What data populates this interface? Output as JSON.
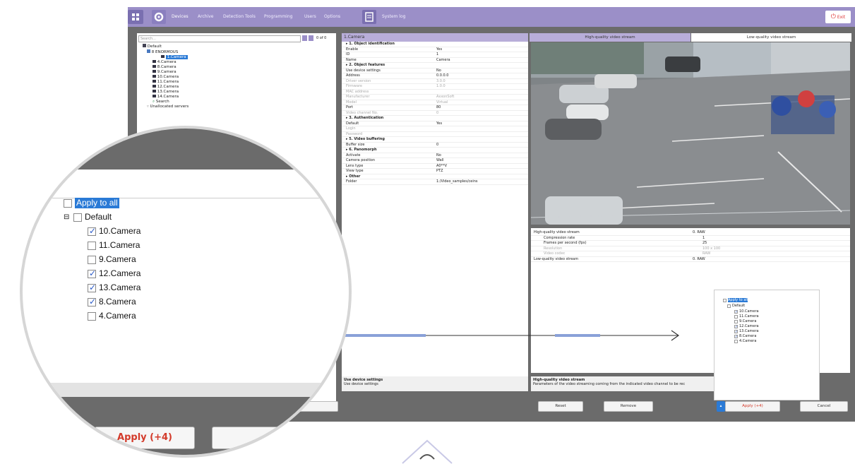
{
  "topbar": {
    "tabs": [
      "Devices",
      "Archive",
      "Detection Tools",
      "Programming",
      "Users",
      "Options"
    ],
    "system_log": "System log",
    "exit": "Exit"
  },
  "left": {
    "search_placeholder": "Search...",
    "search_count": "0 of 0",
    "tree": [
      "Default",
      "8 ENORMOUS",
      "1.Camera",
      "4.Camera",
      "8.Camera",
      "9.Camera",
      "10.Camera",
      "11.Camera",
      "12.Camera",
      "13.Camera",
      "14.Camera",
      "Search",
      "Unallocated servers"
    ]
  },
  "props": {
    "header": "1.Camera",
    "rows": [
      {
        "k": "1. Object identification",
        "v": "",
        "t": "sec"
      },
      {
        "k": "Enable",
        "v": "Yes",
        "t": ""
      },
      {
        "k": "ID",
        "v": "1",
        "t": ""
      },
      {
        "k": "Name",
        "v": "Camera",
        "t": ""
      },
      {
        "k": "2. Object features",
        "v": "",
        "t": "sec"
      },
      {
        "k": "Use device settings",
        "v": "No",
        "t": ""
      },
      {
        "k": "Address",
        "v": "0.0.0.0",
        "t": ""
      },
      {
        "k": "Driver version",
        "v": "3.0.0",
        "t": "dim"
      },
      {
        "k": "Firmware",
        "v": "1.0.0",
        "t": "dim"
      },
      {
        "k": "MAC address",
        "v": "",
        "t": "dim"
      },
      {
        "k": "Manufacturer",
        "v": "AxxonSoft",
        "t": "dim"
      },
      {
        "k": "Model",
        "v": "Virtual",
        "t": "dim"
      },
      {
        "k": "Port",
        "v": "80",
        "t": ""
      },
      {
        "k": "Video channel No.",
        "v": "0",
        "t": "dim"
      },
      {
        "k": "3. Authentication",
        "v": "",
        "t": "sec"
      },
      {
        "k": "Default",
        "v": "Yes",
        "t": ""
      },
      {
        "k": "Login",
        "v": "",
        "t": "dim"
      },
      {
        "k": "Password",
        "v": "",
        "t": "dim"
      },
      {
        "k": "5. Video buffering",
        "v": "",
        "t": "sec"
      },
      {
        "k": "Buffer size",
        "v": "0",
        "t": ""
      },
      {
        "k": "6. Panomorph",
        "v": "",
        "t": "sec"
      },
      {
        "k": "Activate",
        "v": "No",
        "t": ""
      },
      {
        "k": "Camera position",
        "v": "Wall",
        "t": ""
      },
      {
        "k": "Lens type",
        "v": "A0**V",
        "t": ""
      },
      {
        "k": "View type",
        "v": "PTZ",
        "t": ""
      },
      {
        "k": "Other",
        "v": "",
        "t": "sec"
      },
      {
        "k": "Folder",
        "v": "1:/Video_samples/ceins",
        "t": ""
      }
    ],
    "desc_title": "Use device settings",
    "desc_text": "Use device settings"
  },
  "video": {
    "tab_high": "High-quality video stream",
    "tab_low": "Low-quality video stream"
  },
  "streams": {
    "rows": [
      {
        "k": "High-quality video stream",
        "v": "0. RAW"
      },
      {
        "k": "Compression rate",
        "v": "1"
      },
      {
        "k": "Frames per second (fps)",
        "v": "25"
      },
      {
        "k": "Resolution",
        "v": "100 x 100"
      },
      {
        "k": "Video codec",
        "v": "RAW"
      },
      {
        "k": "Low-quality video stream",
        "v": "0. RAW"
      }
    ],
    "desc_title": "High-quality video stream",
    "desc_text": "Parameters of the video streaming coming from the indicated video channel to be rec"
  },
  "buttons": {
    "reset": "Reset",
    "remove": "Remove",
    "apply": "Apply (+4)",
    "cancel": "Cancel",
    "zoom_apply": "Apply (+4)"
  },
  "apply_popup": {
    "apply_all": "Apply to all",
    "group": "Default",
    "items": [
      {
        "label": "10.Camera",
        "checked": true
      },
      {
        "label": "11.Camera",
        "checked": false
      },
      {
        "label": "9.Camera",
        "checked": false
      },
      {
        "label": "12.Camera",
        "checked": true
      },
      {
        "label": "13.Camera",
        "checked": true
      },
      {
        "label": "8.Camera",
        "checked": true
      },
      {
        "label": "4.Camera",
        "checked": false
      }
    ]
  },
  "colors": {
    "accent": "#9b8fc8",
    "apply_red": "#d33a2a",
    "selection": "#2a7ad6"
  }
}
